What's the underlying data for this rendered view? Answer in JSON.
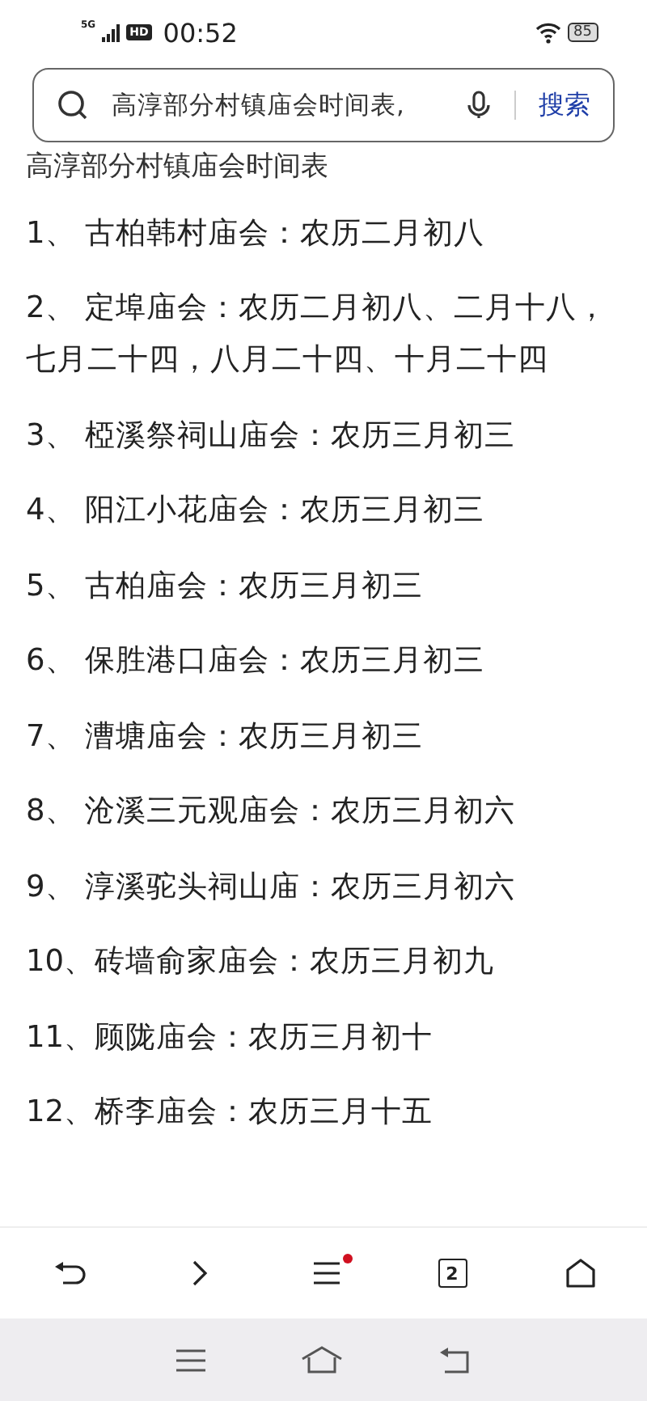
{
  "status_bar": {
    "network": "5G",
    "hd": "HD",
    "time": "00:52",
    "battery": "85"
  },
  "search": {
    "value": "高淳部分村镇庙会时间表,",
    "button": "搜索"
  },
  "article": {
    "heading": "高淳部分村镇庙会时间表",
    "items": [
      "1、 古柏韩村庙会：农历二月初八",
      "2、 定埠庙会：农历二月初八、二月十八，七月二十四，八月二十四、十月二十四",
      "3、 椏溪祭祠山庙会：农历三月初三",
      "4、 阳江小花庙会：农历三月初三",
      "5、 古柏庙会：农历三月初三",
      "6、 保胜港口庙会：农历三月初三",
      "7、 漕塘庙会：农历三月初三",
      "8、 沧溪三元观庙会：农历三月初六",
      "9、 淳溪驼头祠山庙：农历三月初六",
      "10、砖墙俞家庙会：农历三月初九",
      "11、顾陇庙会：农历三月初十",
      "12、桥李庙会：农历三月十五"
    ]
  },
  "toolbar": {
    "tab_count": "2",
    "menu_badge": true
  }
}
